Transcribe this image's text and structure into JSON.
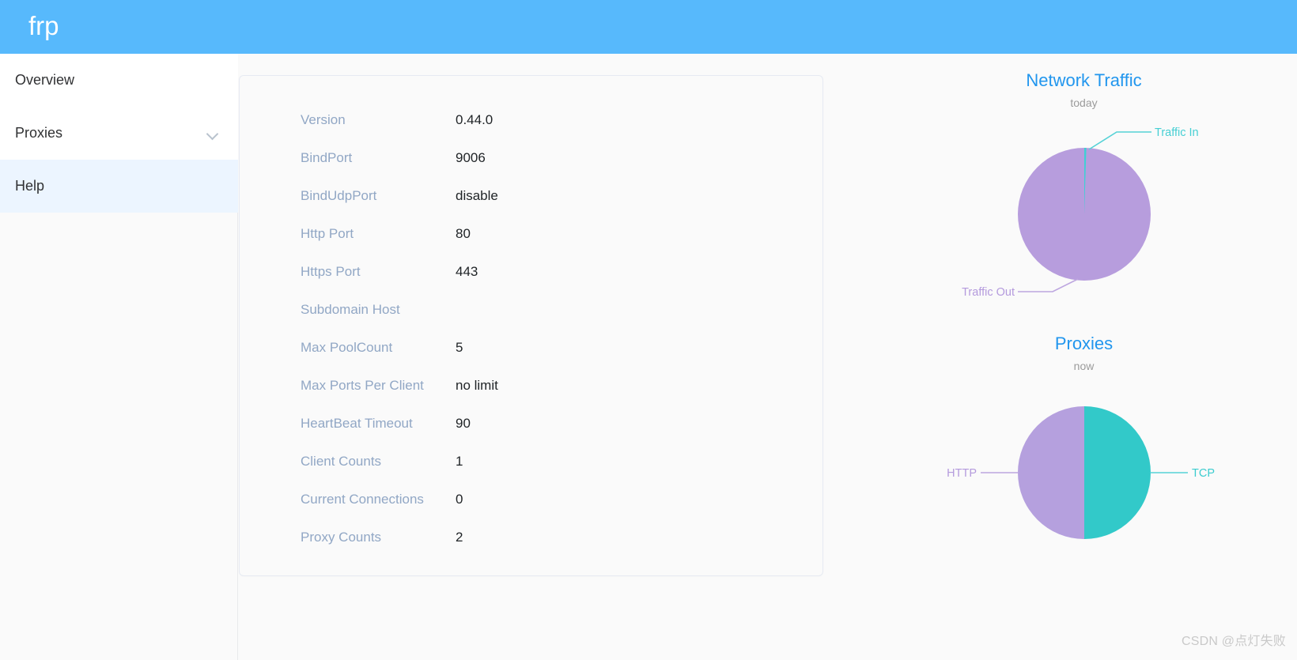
{
  "header": {
    "brand": "frp"
  },
  "sidebar": {
    "items": [
      {
        "label": "Overview",
        "active": false,
        "has_chevron": false
      },
      {
        "label": "Proxies",
        "active": false,
        "has_chevron": true
      },
      {
        "label": "Help",
        "active": true,
        "has_chevron": false
      }
    ]
  },
  "server_info": {
    "rows": [
      {
        "key": "Version",
        "value": "0.44.0"
      },
      {
        "key": "BindPort",
        "value": "9006"
      },
      {
        "key": "BindUdpPort",
        "value": "disable"
      },
      {
        "key": "Http Port",
        "value": "80"
      },
      {
        "key": "Https Port",
        "value": "443"
      },
      {
        "key": "Subdomain Host",
        "value": ""
      },
      {
        "key": "Max PoolCount",
        "value": "5"
      },
      {
        "key": "Max Ports Per Client",
        "value": "no limit"
      },
      {
        "key": "HeartBeat Timeout",
        "value": "90"
      },
      {
        "key": "Client Counts",
        "value": "1"
      },
      {
        "key": "Current Connections",
        "value": "0"
      },
      {
        "key": "Proxy Counts",
        "value": "2"
      }
    ]
  },
  "chart_data": [
    {
      "id": "traffic",
      "type": "pie",
      "title": "Network Traffic",
      "subtitle": "today",
      "legend_position": "callout-labels",
      "categories": [
        "Traffic In",
        "Traffic Out"
      ],
      "values": [
        0.6,
        99.4
      ],
      "colors": [
        "#3fd0d4",
        "#b79ddd"
      ],
      "label_in": "Traffic In",
      "label_out": "Traffic Out"
    },
    {
      "id": "proxies",
      "type": "pie",
      "title": "Proxies",
      "subtitle": "now",
      "legend_position": "callout-labels",
      "categories": [
        "HTTP",
        "TCP"
      ],
      "values": [
        50,
        50
      ],
      "colors": [
        "#b5a0de",
        "#32c9c9"
      ],
      "label_http": "HTTP",
      "label_tcp": "TCP"
    }
  ],
  "watermark": {
    "text": "CSDN @点灯失败"
  }
}
